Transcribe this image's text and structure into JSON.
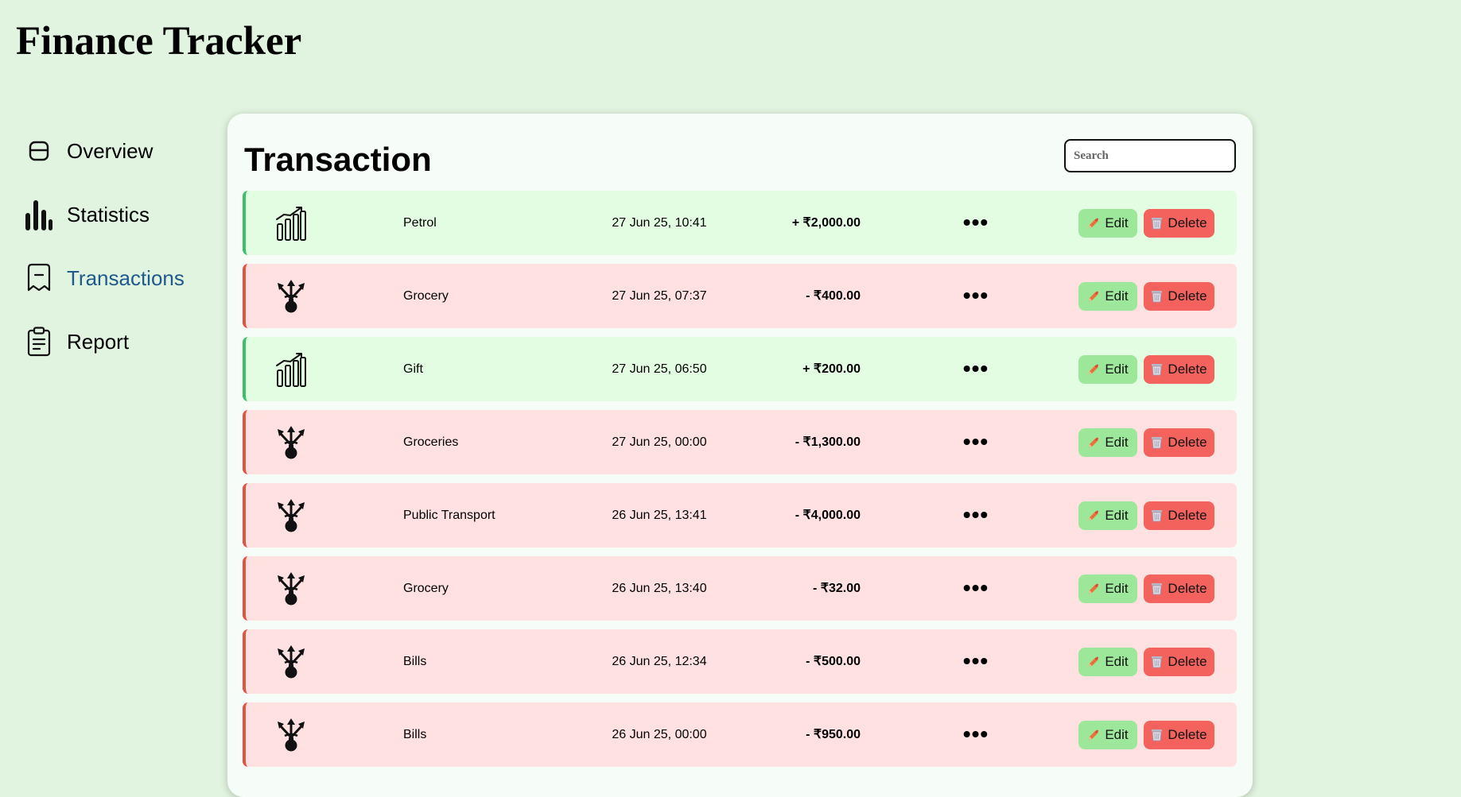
{
  "app": {
    "title": "Finance Tracker"
  },
  "sidebar": {
    "items": [
      {
        "label": "Overview",
        "icon": "overview-icon",
        "active": false
      },
      {
        "label": "Statistics",
        "icon": "statistics-icon",
        "active": false
      },
      {
        "label": "Transactions",
        "icon": "transactions-icon",
        "active": true
      },
      {
        "label": "Report",
        "icon": "report-icon",
        "active": false
      }
    ]
  },
  "main": {
    "title": "Transaction",
    "search_placeholder": "Search",
    "edit_label": "Edit",
    "delete_label": "Delete",
    "more_label": "•••",
    "transactions": [
      {
        "category": "Petrol",
        "date": "27 Jun 25, 10:41",
        "amount": "+ ₹2,000.00",
        "type": "income",
        "icon": "income-chart-icon"
      },
      {
        "category": "Grocery",
        "date": "27 Jun 25, 07:37",
        "amount": "- ₹400.00",
        "type": "expense",
        "icon": "expense-money-bag-icon"
      },
      {
        "category": "Gift",
        "date": "27 Jun 25, 06:50",
        "amount": "+ ₹200.00",
        "type": "income",
        "icon": "income-chart-icon"
      },
      {
        "category": "Groceries",
        "date": "27 Jun 25, 00:00",
        "amount": "- ₹1,300.00",
        "type": "expense",
        "icon": "expense-money-bag-icon"
      },
      {
        "category": "Public Transport",
        "date": "26 Jun 25, 13:41",
        "amount": "- ₹4,000.00",
        "type": "expense",
        "icon": "expense-money-bag-icon"
      },
      {
        "category": "Grocery",
        "date": "26 Jun 25, 13:40",
        "amount": "- ₹32.00",
        "type": "expense",
        "icon": "expense-money-bag-icon"
      },
      {
        "category": "Bills",
        "date": "26 Jun 25, 12:34",
        "amount": "- ₹500.00",
        "type": "expense",
        "icon": "expense-money-bag-icon"
      },
      {
        "category": "Bills",
        "date": "26 Jun 25, 00:00",
        "amount": "- ₹950.00",
        "type": "expense",
        "icon": "expense-money-bag-icon"
      }
    ]
  },
  "colors": {
    "background": "#e0f4df",
    "income_bg": "#e3fde3",
    "income_border": "#3cbf65",
    "expense_bg": "#ffe1e1",
    "expense_border": "#e05444",
    "edit_button": "#9ce79a",
    "delete_button": "#f3625c",
    "active_nav": "#1e5a8c"
  }
}
